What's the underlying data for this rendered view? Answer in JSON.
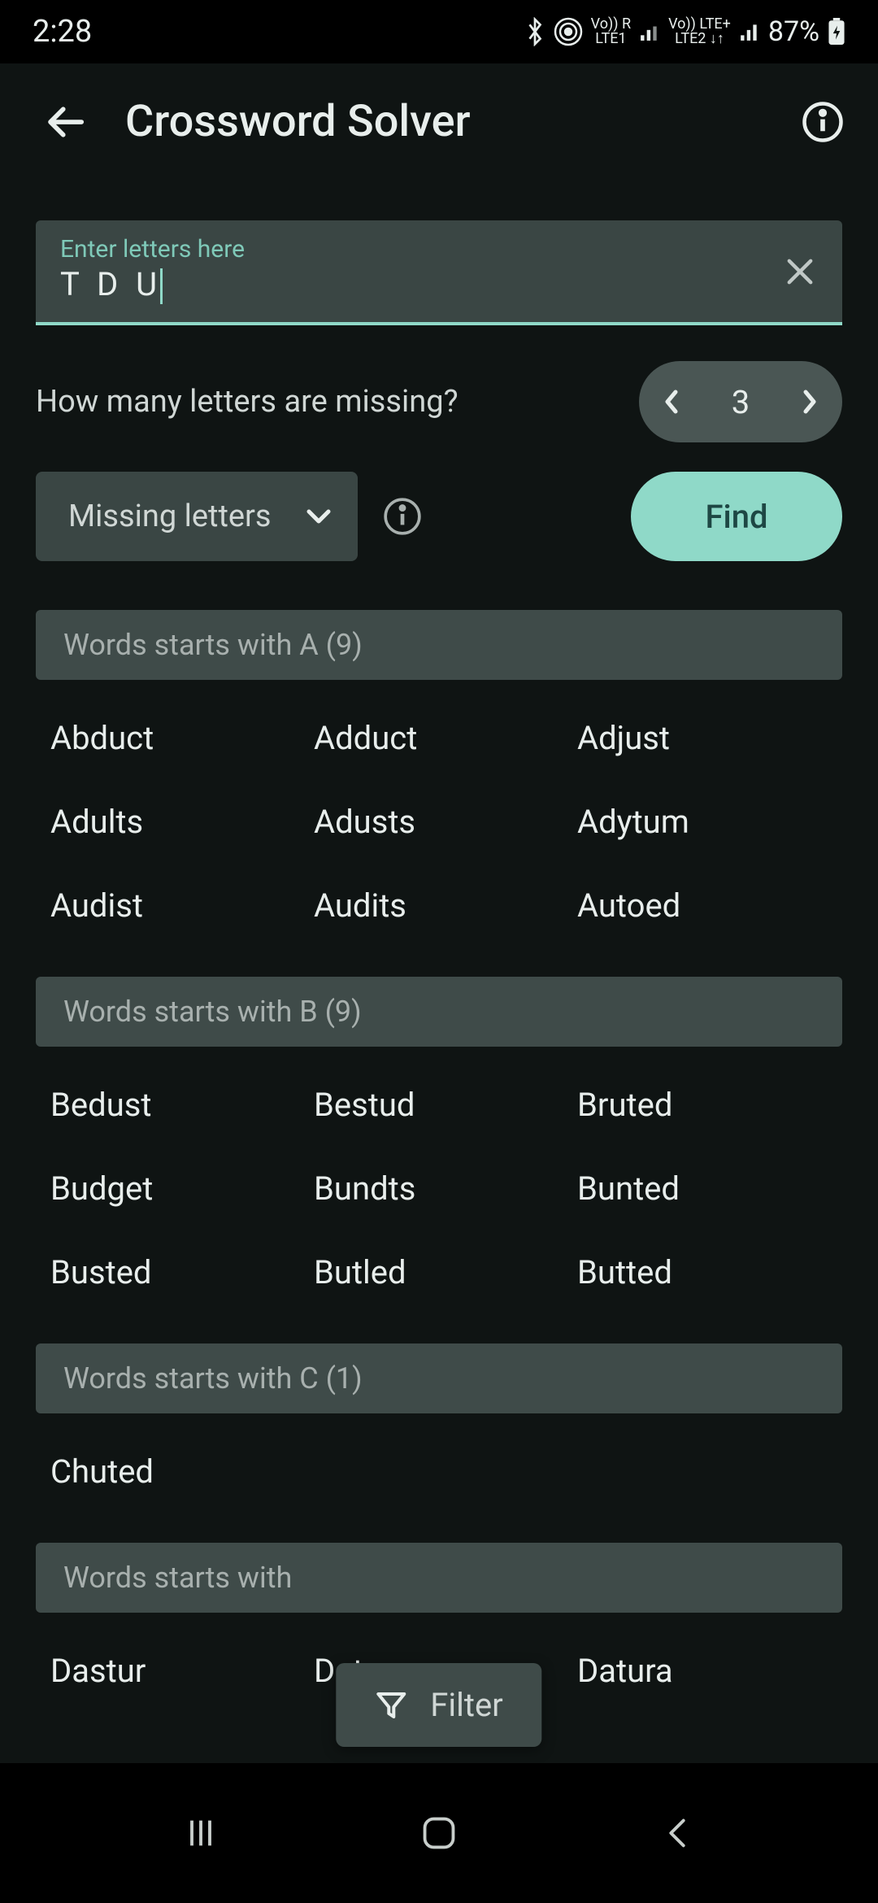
{
  "status": {
    "time": "2:28",
    "lte1": "LTE1",
    "lte2": "LTE2",
    "battery": "87%"
  },
  "header": {
    "title": "Crossword Solver"
  },
  "input": {
    "label": "Enter letters here",
    "value": "T D U"
  },
  "missing": {
    "question": "How many letters are missing?",
    "count": "3"
  },
  "dropdown": {
    "label": "Missing letters"
  },
  "find_label": "Find",
  "filter_label": "Filter",
  "sections": [
    {
      "title": "Words starts with A (9)",
      "words": [
        "Abduct",
        "Adduct",
        "Adjust",
        "Adults",
        "Adusts",
        "Adytum",
        "Audist",
        "Audits",
        "Autoed"
      ]
    },
    {
      "title": "Words starts with B (9)",
      "words": [
        "Bedust",
        "Bestud",
        "Bruted",
        "Budget",
        "Bundts",
        "Bunted",
        "Busted",
        "Butled",
        "Butted"
      ]
    },
    {
      "title": "Words starts with C (1)",
      "words": [
        "Chuted"
      ]
    },
    {
      "title": "Words starts with",
      "words": [
        "Dastur",
        "Datums",
        "Datura"
      ]
    }
  ]
}
